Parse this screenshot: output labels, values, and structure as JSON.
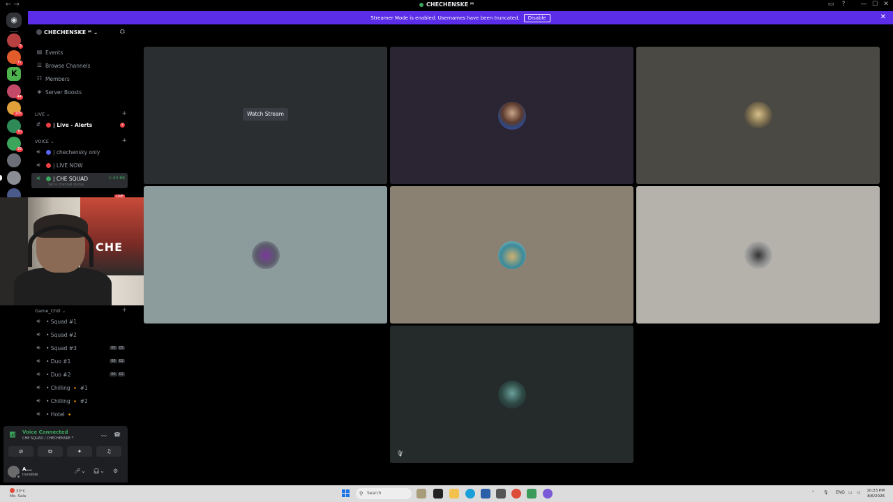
{
  "window": {
    "title": "CHECHENSKE ᴹ",
    "controls": [
      "▭",
      "?",
      "—",
      "☐",
      "✕"
    ]
  },
  "banner": {
    "message": "Streamer Mode is enabled. Usernames have been truncated.",
    "disable_label": "Disable",
    "close": "✕"
  },
  "rail": {
    "home_icon": "discord-icon",
    "servers": [
      {
        "color": "#b84040",
        "badge": "5"
      },
      {
        "color": "#e25c2b",
        "badge": "77"
      },
      {
        "color": "#4db34d",
        "badge": ""
      },
      {
        "color": "#c24a68",
        "badge": "44"
      },
      {
        "color": "#e0a13a",
        "badge": "105"
      },
      {
        "color": "#2e8b57",
        "badge": "70"
      },
      {
        "color": "#3ba55c",
        "badge": "38"
      },
      {
        "color": "#6c6f78",
        "badge": ""
      },
      {
        "color": "#8a8d94",
        "badge": ""
      },
      {
        "color": "#4a5a8a",
        "badge": ""
      }
    ]
  },
  "sidebar": {
    "server_name": "CHECHENSKE ᴹ",
    "nav": [
      {
        "label": "Events",
        "icon": "▤"
      },
      {
        "label": "Browse Channels",
        "icon": "☰"
      },
      {
        "label": "Members",
        "icon": "☷"
      },
      {
        "label": "Server Boosts",
        "icon": "◈"
      }
    ],
    "categories": {
      "live": "LIVE ⌄",
      "voice": "VOICE ⌄",
      "game_chill": "Game_Chill ⌄"
    },
    "live_channel": {
      "label": "| Live - Alerts",
      "badge": "2"
    },
    "voice_channels": [
      {
        "label": "| chechensky only",
        "dot": "#5865f2"
      },
      {
        "label": "| LIVE NOW",
        "dot": "#f23f43"
      },
      {
        "label": "| CHE SQUAD",
        "dot": "#3ba55c",
        "time": "1:43:88",
        "status": "Set a channel status"
      }
    ],
    "game_channels": [
      {
        "label": "• Squad #1",
        "count": ""
      },
      {
        "label": "• Squad #2",
        "count": ""
      },
      {
        "label": "• Squad #3",
        "count_a": "00",
        "count_b": "05"
      },
      {
        "label": "• Duo #1",
        "count_a": "00",
        "count_b": "02"
      },
      {
        "label": "• Duo #2",
        "count_a": "00",
        "count_b": "02"
      },
      {
        "label": "• Chilling 🔸 #1",
        "count": ""
      },
      {
        "label": "• Chilling 🔸 #2",
        "count": ""
      },
      {
        "label": "• Hotel 🔸",
        "count": ""
      }
    ],
    "live_tag": "LIVE"
  },
  "webcam": {
    "poster_text": "CHE"
  },
  "voice_panel": {
    "title": "Voice Connected",
    "subtitle": "CHE SQUAD / CHECHENSKE ᴹ"
  },
  "user_panel": {
    "name": "A...",
    "status": "Invisible"
  },
  "tiles": {
    "watch_stream": "Watch Stream"
  },
  "taskbar": {
    "weather_temp": "33°C",
    "weather_desc": "Mo. Sala",
    "search_placeholder": "Search",
    "lang": "ENG",
    "time": "10:23 PM",
    "date": "8/6/2026"
  }
}
